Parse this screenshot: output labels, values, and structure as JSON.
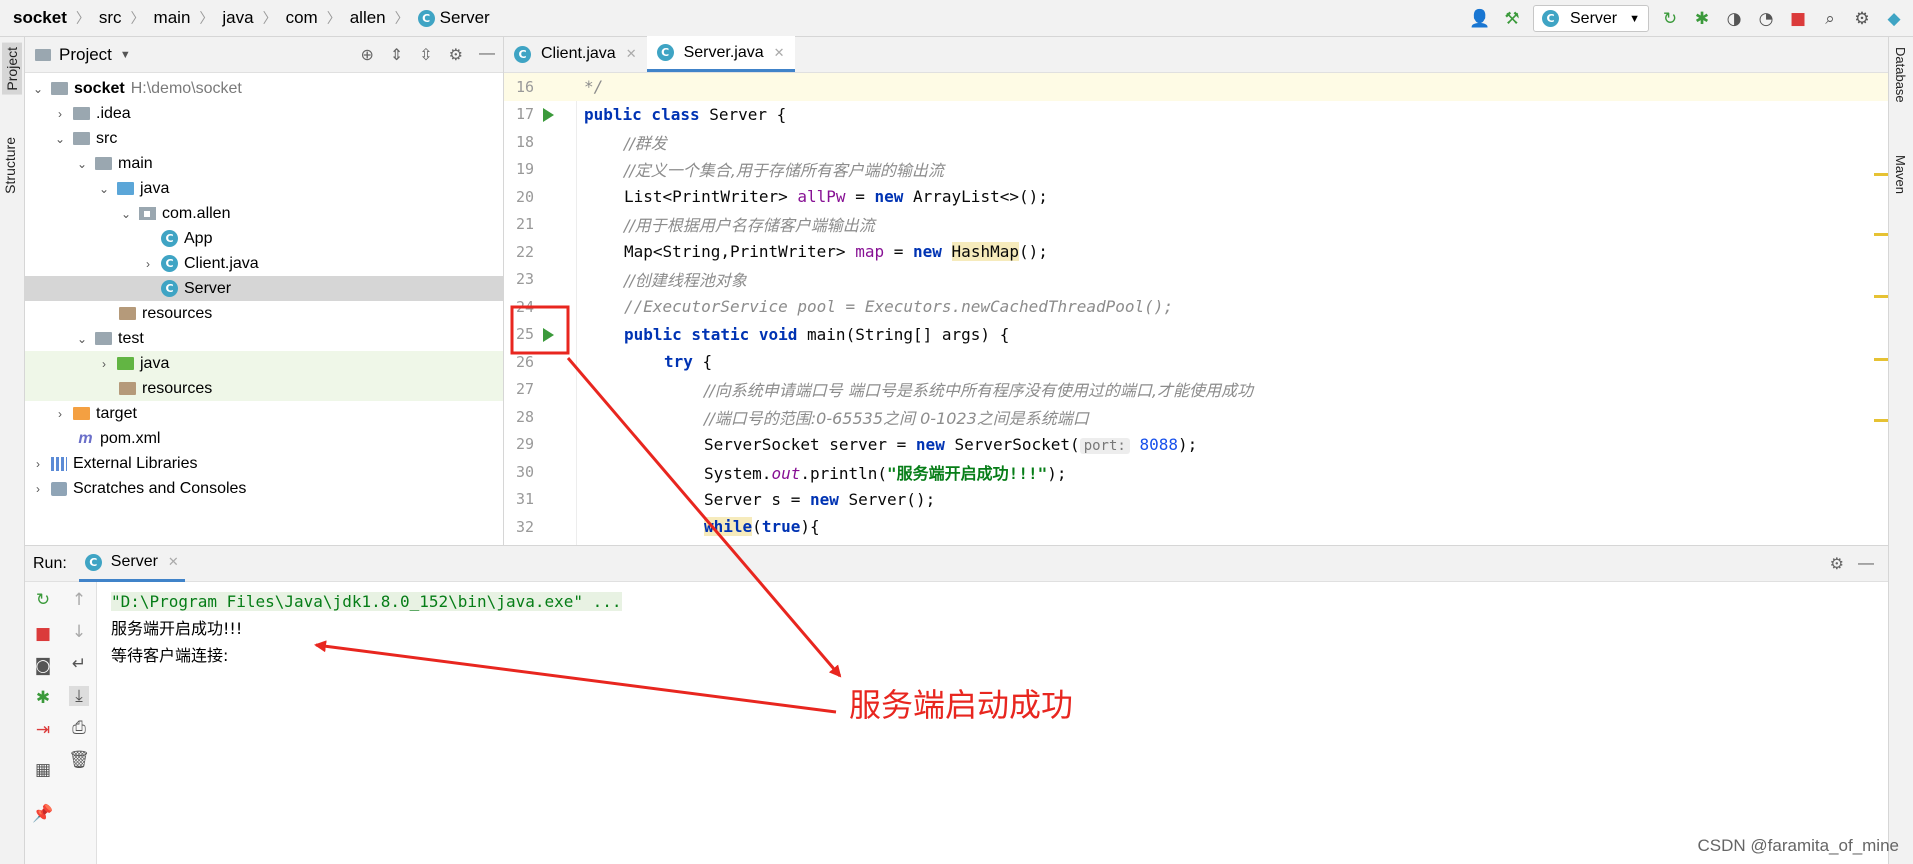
{
  "breadcrumb": [
    "socket",
    "src",
    "main",
    "java",
    "com",
    "allen",
    "Server"
  ],
  "toolbar": {
    "run_config": "Server"
  },
  "left_strip": {
    "project_tab": "Project",
    "structure_tab": "Structure"
  },
  "right_strip": {
    "database_tab": "Database",
    "maven_tab": "Maven"
  },
  "project": {
    "title": "Project",
    "tree": [
      {
        "label": "socket",
        "extra": "H:\\demo\\socket"
      },
      {
        "label": ".idea"
      },
      {
        "label": "src"
      },
      {
        "label": "main"
      },
      {
        "label": "java"
      },
      {
        "label": "com.allen"
      },
      {
        "label": "App"
      },
      {
        "label": "Client.java"
      },
      {
        "label": "Server"
      },
      {
        "label": "resources"
      },
      {
        "label": "test"
      },
      {
        "label": "java"
      },
      {
        "label": "resources"
      },
      {
        "label": "target"
      },
      {
        "label": "pom.xml"
      },
      {
        "label": "External Libraries"
      },
      {
        "label": "Scratches and Consoles"
      }
    ]
  },
  "editor": {
    "tabs": [
      {
        "label": "Client.java"
      },
      {
        "label": "Server.java"
      }
    ],
    "warnings": "6",
    "lines": [
      "16",
      "17",
      "18",
      "19",
      "20",
      "21",
      "22",
      "23",
      "24",
      "25",
      "26",
      "27",
      "28",
      "29",
      "30",
      "31",
      "32"
    ],
    "code": {
      "l16": "*/",
      "l17a": "public class ",
      "l17b": "Server {",
      "l18": "//群发",
      "l19": "//定义一个集合,用于存储所有客户端的输出流",
      "l20a": "List<PrintWriter> ",
      "l20b": "allPw",
      "l20c": " = ",
      "l20d": "new",
      "l20e": " ArrayList<>();",
      "l21": "//用于根据用户名存储客户端输出流",
      "l22a": "Map<String,PrintWriter> ",
      "l22b": "map",
      "l22c": " = ",
      "l22d": "new",
      "l22e": "HashMap",
      "l22f": "();",
      "l23": "//创建线程池对象",
      "l24": "//ExecutorService pool = Executors.newCachedThreadPool();",
      "l25a": "public static void ",
      "l25b": "main(String[] args) {",
      "l26a": "try",
      "l26b": " {",
      "l27": "//向系统申请端口号 端口号是系统中所有程序没有使用过的端口,才能使用成功",
      "l28": "//端口号的范围:0-65535之间 0-1023之间是系统端口",
      "l29a": "ServerSocket server = ",
      "l29b": "new",
      "l29c": " ServerSocket(",
      "l29hint": "port:",
      "l29num": "8088",
      "l29d": ");",
      "l30a": "System.",
      "l30b": "out",
      "l30c": ".println(",
      "l30str": "\"服务端开启成功!!!\"",
      "l30d": ");",
      "l31a": "Server s = ",
      "l31b": "new",
      "l31c": " Server();",
      "l32a": "while",
      "l32b": "(",
      "l32c": "true",
      "l32d": "){"
    }
  },
  "run": {
    "label": "Run:",
    "tab": "Server",
    "console": [
      "\"D:\\Program Files\\Java\\jdk1.8.0_152\\bin\\java.exe\" ...",
      "服务端开启成功!!!",
      "等待客户端连接:"
    ]
  },
  "annotation": {
    "text": "服务端启动成功",
    "color": "#e8261f"
  },
  "watermark": "CSDN @faramita_of_mine"
}
